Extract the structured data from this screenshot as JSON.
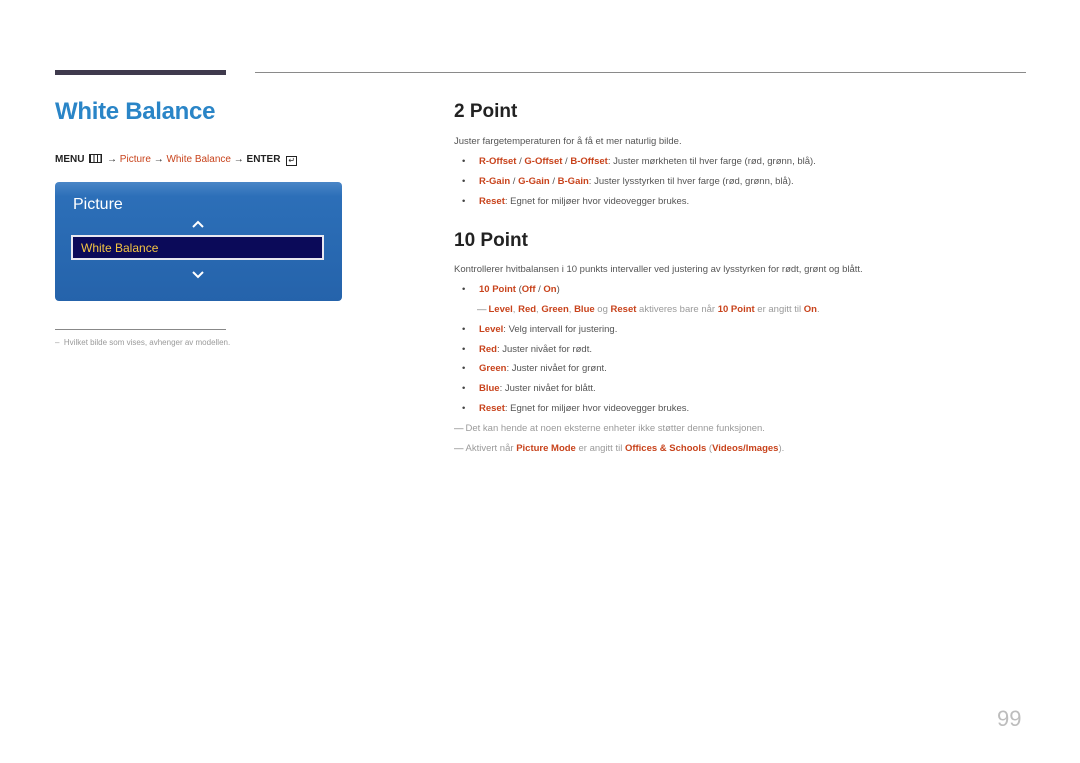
{
  "header": {
    "title": "White Balance"
  },
  "menu_path": {
    "menu": "MENU",
    "arrow": "→",
    "picture": "Picture",
    "white_balance": "White Balance",
    "enter": "ENTER"
  },
  "osd": {
    "title": "Picture",
    "selected_item": "White Balance",
    "up_icon": "chevron-up-icon",
    "down_icon": "chevron-down-icon"
  },
  "footnote": {
    "dash": "–",
    "text": "Hvilket bilde som vises, avhenger av modellen."
  },
  "two_point": {
    "heading": "2 Point",
    "intro": "Juster fargetemperaturen for å få et mer naturlig bilde.",
    "items": [
      {
        "parts": [
          "R-Offset",
          " / ",
          "G-Offset",
          " / ",
          "B-Offset"
        ],
        "desc": ": Juster mørkheten til hver farge (rød, grønn, blå)."
      },
      {
        "parts": [
          "R-Gain",
          " / ",
          "G-Gain",
          " / ",
          "B-Gain"
        ],
        "desc": ": Juster lysstyrken til hver farge (rød, grønn, blå)."
      },
      {
        "parts": [
          "Reset"
        ],
        "desc": ": Egnet for miljøer hvor videovegger brukes."
      }
    ]
  },
  "ten_point": {
    "heading": "10 Point",
    "intro": "Kontrollerer hvitbalansen i 10 punkts intervaller ved justering av lysstyrken for rødt, grønt og blått.",
    "toggle": {
      "name": "10 Point",
      "open": " (",
      "off": "Off",
      "sep": " / ",
      "on": "On",
      "close": ")"
    },
    "toggle_note": {
      "level": "Level",
      "red": "Red",
      "green": "Green",
      "blue": "Blue",
      "og": " og ",
      "reset": "Reset",
      "mid": " aktiveres bare når ",
      "ten_point": "10 Point",
      "tail": " er angitt til ",
      "on": "On",
      "end": "."
    },
    "items": [
      {
        "name": "Level",
        "desc": ": Velg intervall for justering."
      },
      {
        "name": "Red",
        "desc": ": Juster nivået for rødt."
      },
      {
        "name": "Green",
        "desc": ": Juster nivået for grønt."
      },
      {
        "name": "Blue",
        "desc": ": Juster nivået for blått."
      },
      {
        "name": "Reset",
        "desc": ": Egnet for miljøer hvor videovegger brukes."
      }
    ],
    "notes": {
      "external": "Det kan hende at noen eksterne enheter ikke støtter denne funksjonen.",
      "activated_prefix": "Aktivert når ",
      "picture_mode": "Picture Mode",
      "activated_mid": " er angitt til ",
      "offices": "Offices & Schools",
      "paren_open": " (",
      "videos": "Videos/Images",
      "paren_close": ")."
    }
  },
  "page_number": "99"
}
